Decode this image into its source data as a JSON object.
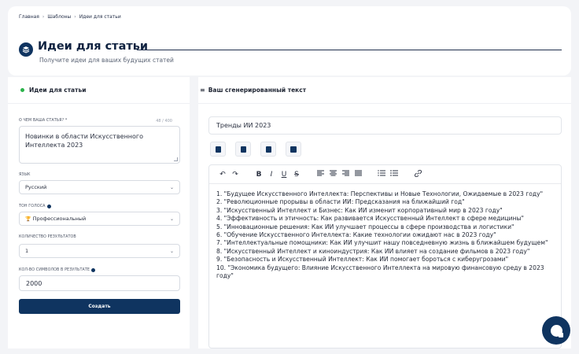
{
  "breadcrumb": {
    "home": "Главная",
    "sep1": "›",
    "templates": "Шаблоны",
    "sep2": "›",
    "current": "Идеи для статьи"
  },
  "header": {
    "title": "Идеи для статьи",
    "subtitle": "Получите идеи для ваших будущих статей"
  },
  "left_panel": {
    "title": "Идеи для статьи",
    "topic": {
      "label": "О ЧЕМ ВАША СТАТЬЯ? *",
      "counter": "48 / 400",
      "value": "Новинки в области Искусственного Интеллекта 2023"
    },
    "language": {
      "label": "ЯЗЫК",
      "value": "Русский"
    },
    "tone": {
      "label": "ТОН ГОЛОСА",
      "icon": "🏆",
      "value": "Профессиональный"
    },
    "results_count": {
      "label": "КОЛИЧЕСТВО РЕЗУЛЬТАТОВ",
      "value": "1"
    },
    "char_count": {
      "label": "КОЛ-ВО СИМВОЛОВ В РЕЗУЛЬТАТЕ",
      "value": "2000"
    },
    "create_label": "Создать"
  },
  "right_panel": {
    "title": "Ваш сгенерированный текст",
    "doc_title": "Тренды ИИ 2023",
    "toolbar": {
      "undo": "↶",
      "redo": "↷",
      "bold": "B",
      "italic": "I",
      "underline": "U",
      "strike": "S",
      "ordered_list": "⋮≡",
      "bullet_list": "⁝≡",
      "link": "🔗"
    },
    "content": [
      "1. \"Будущее Искусственного Интеллекта: Перспективы и Новые Технологии, Ожидаемые в 2023 году\"",
      "2. \"Революционные прорывы в области ИИ: Предсказания на ближайший год\"",
      "3. \"Искусственный Интеллект и Бизнес: Как ИИ изменит корпоративный мир в 2023 году\"",
      "4. \"Эффективность и этичность: Как развивается Искусственный Интеллект в сфере медицины\"",
      "5. \"Инновационные решения: Как ИИ улучшает процессы в сфере производства и логистики\"",
      "6. \"Обучение Искусственного Интеллекта: Какие технологии ожидают нас в 2023 году\"",
      "7. \"Интеллектуальные помощники: Как ИИ улучшит нашу повседневную жизнь в ближайшем будущем\"",
      "8. \"Искусственный Интеллект и киноиндустрия: Как ИИ влияет на создание фильмов в 2023 году\"",
      "9. \"Безопасность и Искусственный Интеллект: Как ИИ помогает бороться с киберугрозами\"",
      "10. \"Экономика будущего: Влияние Искусственного Интеллекта на мировую финансовую среду в 2023 году\""
    ]
  },
  "colors": {
    "primary": "#0f3460",
    "status_dot": "#2bb34a",
    "background": "#f3f4f7"
  }
}
